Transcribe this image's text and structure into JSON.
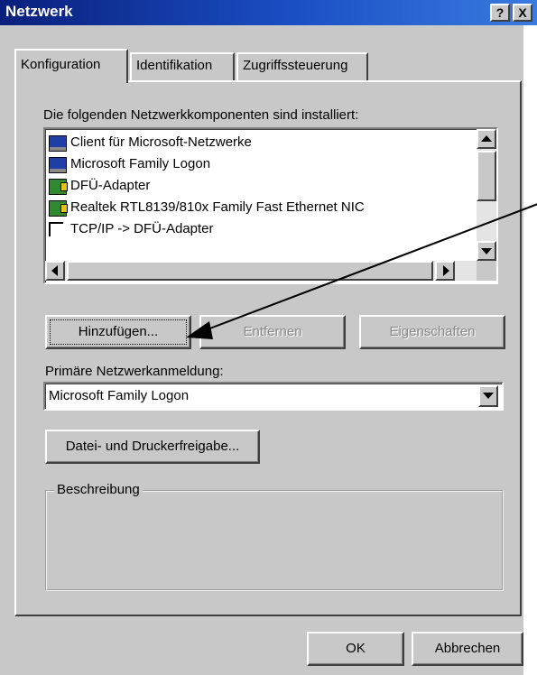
{
  "window": {
    "title": "Netzwerk",
    "help_label": "?",
    "close_label": "X"
  },
  "tabs": [
    {
      "label": "Konfiguration"
    },
    {
      "label": "Identifikation"
    },
    {
      "label": "Zugriffssteuerung"
    }
  ],
  "components": {
    "label": "Die folgenden Netzwerkkomponenten sind installiert:",
    "items": [
      {
        "label": "Client für Microsoft-Netzwerke",
        "icon": "network-client-icon"
      },
      {
        "label": "Microsoft Family Logon",
        "icon": "network-client-icon"
      },
      {
        "label": "DFÜ-Adapter",
        "icon": "network-adapter-icon"
      },
      {
        "label": "Realtek RTL8139/810x Family Fast Ethernet NIC",
        "icon": "network-adapter-icon"
      },
      {
        "label": "TCP/IP -> DFÜ-Adapter",
        "icon": "protocol-icon"
      }
    ]
  },
  "buttons": {
    "add": "Hinzufügen...",
    "remove": "Entfernen",
    "properties": "Eigenschaften",
    "file_print_sharing": "Datei- und Druckerfreigabe...",
    "ok": "OK",
    "cancel": "Abbrechen"
  },
  "primary_logon": {
    "label": "Primäre Netzwerkanmeldung:",
    "selected": "Microsoft Family Logon"
  },
  "description": {
    "label": "Beschreibung",
    "text": ""
  },
  "colors": {
    "title_bar_start": "#0a1f7c",
    "title_bar_end": "#3a7be0",
    "face": "#c8c8c8"
  }
}
